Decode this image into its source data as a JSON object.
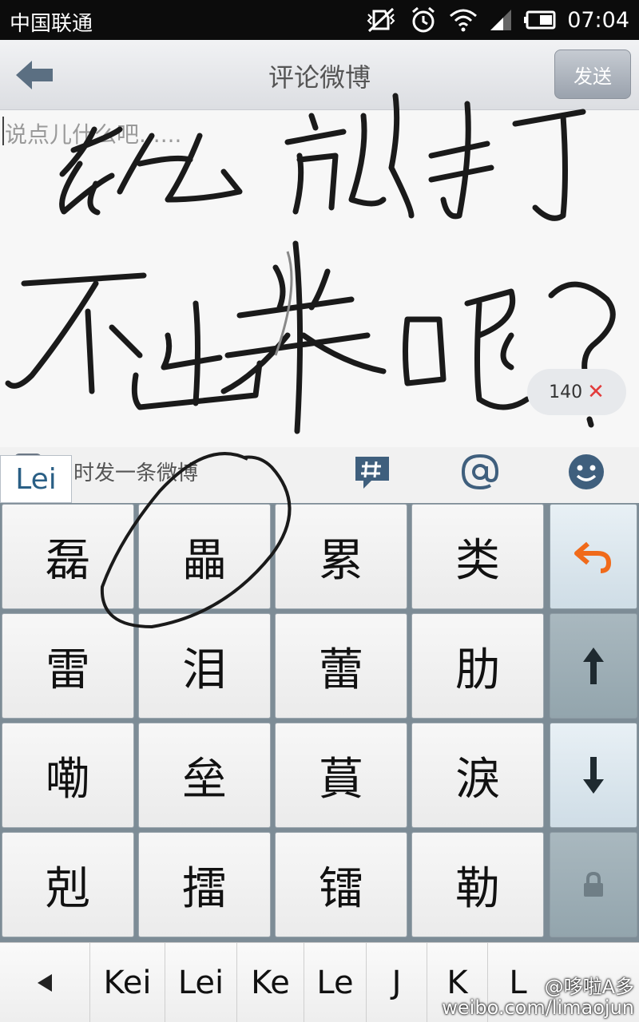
{
  "status_bar": {
    "carrier": "中国联通",
    "time": "07:04",
    "icons": [
      "vibrate-off-icon",
      "alarm-icon",
      "wifi-icon",
      "signal-icon",
      "battery-icon"
    ]
  },
  "title_bar": {
    "title": "评论微博",
    "send_label": "发送",
    "back_icon": "back-arrow-icon"
  },
  "editor": {
    "placeholder": "说点儿什么吧......",
    "char_remaining": "140",
    "clear_icon": "clear-x-icon"
  },
  "toolbar": {
    "repost_label": "时发一条微博",
    "icons": [
      "hashtag-icon",
      "at-icon",
      "emoticon-icon"
    ]
  },
  "ime": {
    "composing_pinyin": "Lei",
    "candidates": [
      [
        "磊",
        "畾",
        "累",
        "类"
      ],
      [
        "雷",
        "泪",
        "蕾",
        "肋"
      ],
      [
        "嘞",
        "垒",
        "蒷",
        "淚"
      ],
      [
        "剋",
        "擂",
        "镭",
        "勒"
      ]
    ],
    "side_keys": [
      "undo-icon",
      "arrow-up-icon",
      "arrow-down-icon",
      "lock-icon"
    ],
    "pinyin_options": [
      "Kei",
      "Lei",
      "Ke",
      "Le",
      "J",
      "K",
      "L"
    ]
  },
  "watermark": {
    "line1": "@哆啦A多",
    "line2": "weibo.com/limaojun"
  },
  "colors": {
    "accent_orange": "#f06a1a",
    "pinyin_blue": "#2a5f85",
    "keyboard_bg": "#7d8c96"
  }
}
